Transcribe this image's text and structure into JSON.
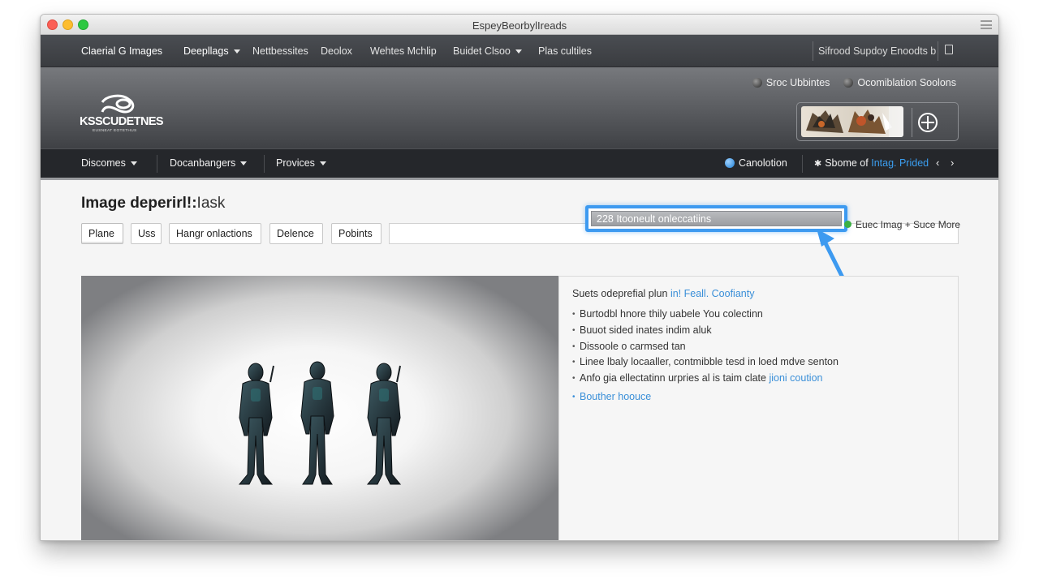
{
  "window": {
    "title": "EspeyBeorbylIreads"
  },
  "topnav": {
    "items": [
      {
        "label": "Claerial G Images",
        "bold": true
      },
      {
        "label": "Deepllags",
        "dropdown": true
      },
      {
        "label": "Nettbessites"
      },
      {
        "label": "Deolox"
      },
      {
        "label": "Wehtes Mchlip"
      },
      {
        "label": "Buidet Clsoo",
        "dropdown": true
      },
      {
        "label": "Plas cultiles"
      }
    ],
    "right_text": "Sifrood Supdoy Enoodts b"
  },
  "hero": {
    "logo_text": "KSSCUDETNES",
    "logo_tagline": "EUSNEAT EOTETHUS",
    "links": [
      {
        "label": "Sroc Ubbintes"
      },
      {
        "label": "Ocomiblation Soolons"
      }
    ]
  },
  "secnav": {
    "items": [
      {
        "label": "Discomes"
      },
      {
        "label": "Docanbangers"
      },
      {
        "label": "Provices"
      }
    ],
    "canolotion": "Canolotion",
    "status_prefix": "Sbome of",
    "status_link": "Intag. Prided"
  },
  "content": {
    "title": "Image deperirl!:",
    "title_suffix": "Iask",
    "tabs": [
      "Plane",
      "Uss",
      "Hangr onlactions",
      "Delence",
      "Pobints"
    ],
    "search_value": "228 Itooneult onleccatiins",
    "right_link": "Euec Imag + Suce More",
    "info": {
      "intro": "Suets odeprefial plun",
      "intro_link": "in! Feall. Coofianty",
      "bullets": [
        {
          "text": "Burtodbl hnore thily uabele     You colectinn"
        },
        {
          "text": "Buuot sided inates indim aluk"
        },
        {
          "text": "Dissoole o carmsed tan"
        },
        {
          "text": "Linee lbaly locaaller, contmibble tesd in loed mdve senton"
        },
        {
          "text": "Anfo gia ellectatinn urpries al is taim clate",
          "link": "jioni coution"
        }
      ],
      "footer_link": "Bouther hoouce"
    }
  },
  "colors": {
    "accent": "#3d9af0",
    "link": "#3a8fd8",
    "topnav_bg": "#3f4145",
    "secnav_bg": "#25272b"
  },
  "icons": {
    "hero_action": "crosshair-icon",
    "nav_prev": "chevron-left-icon",
    "nav_next": "chevron-right-icon"
  }
}
